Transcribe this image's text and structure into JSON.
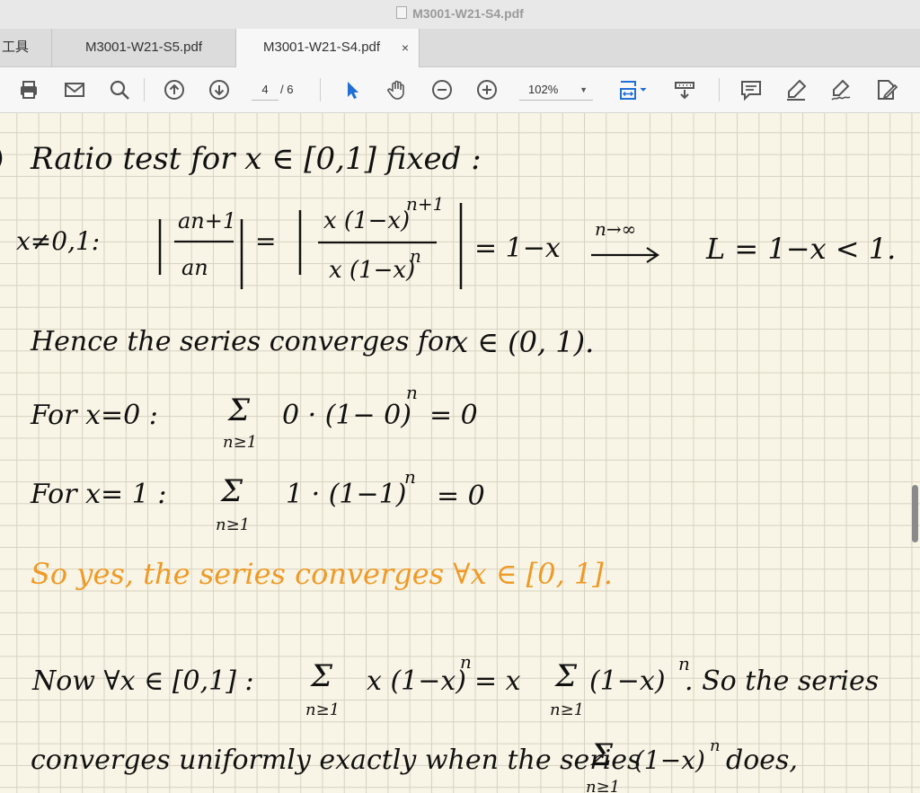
{
  "window": {
    "title": "M3001-W21-S4.pdf"
  },
  "tabs": {
    "tools": "工具",
    "s5": "M3001-W21-S5.pdf",
    "s4": "M3001-W21-S4.pdf",
    "close": "×"
  },
  "toolbar": {
    "page_current": "4",
    "page_total": "/ 6",
    "zoom": "102%",
    "icons": [
      "print-icon",
      "email-icon",
      "search-icon",
      "prev-page-icon",
      "next-page-icon",
      "select-cursor-icon",
      "hand-tool-icon",
      "zoom-out-icon",
      "zoom-in-icon",
      "fit-width-icon",
      "scroll-mode-icon",
      "comment-icon",
      "highlight-icon",
      "sign-icon",
      "edit-pdf-icon"
    ]
  },
  "colors": {
    "ink": "#111111",
    "highlight_ink": "#ef9a26",
    "paper": "#f9f5e6",
    "grid": "#d6d2c2"
  },
  "notes": {
    "line1": "Ratio test for x ∈ [0,1] fixed :",
    "case_label": "x≠0,1:",
    "frac1_num": "an+1",
    "frac1_den": "an",
    "equals": "=",
    "frac2_num": "x (1−x)",
    "frac2_num_exp": "n+1",
    "frac2_den": "x (1−x)",
    "frac2_den_exp": "n",
    "result": "= 1−x",
    "limit_label": "n→∞",
    "limit_result": "L = 1−x < 1.",
    "line3": "Hence the series converges for",
    "line3_set": "x ∈ (0, 1).",
    "line4_label": "For x=0 :",
    "line4_sum": "Σ",
    "line4_idx": "n≥1",
    "line4_expr": "0 · (1− 0)",
    "line4_exp": "n",
    "line4_res": "= 0",
    "line5_label": "For x= 1 :",
    "line5_sum": "Σ",
    "line5_idx": "n≥1",
    "line5_expr": "1 · (1−1)",
    "line5_exp": "n",
    "line5_res": "= 0",
    "line6": "So yes, the series converges ∀x ∈ [0, 1].",
    "line7_label": "Now ∀x ∈ [0,1] :",
    "line7_sum": "Σ",
    "line7_idx": "n≥1",
    "line7_expr": "x (1−x)",
    "line7_exp": "n",
    "line7_mid": "= x",
    "line7_sum2": "Σ",
    "line7_idx2": "n≥1",
    "line7_expr2": "(1−x)",
    "line7_exp2": "n",
    "line7_tail": ". So the series",
    "line8": "converges uniformly exactly when the series",
    "line8_sum": "Σ",
    "line8_idx": "n≥1",
    "line8_expr": "(1−x)",
    "line8_exp": "n",
    "line8_tail": "does,"
  }
}
